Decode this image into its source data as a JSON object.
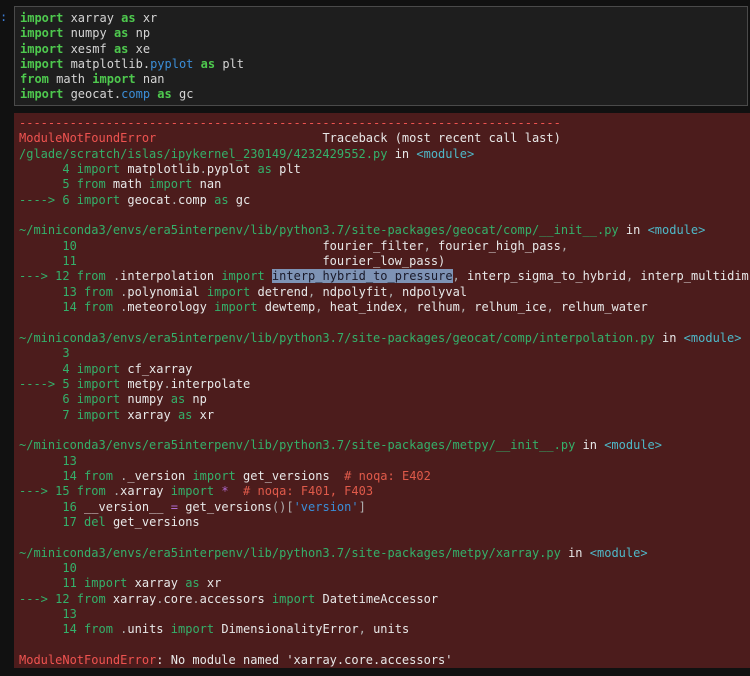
{
  "prompt": ":",
  "input_code": [
    [
      [
        "kw",
        "import"
      ],
      [
        "plain",
        " xarray "
      ],
      [
        "kw",
        "as"
      ],
      [
        "plain",
        " xr"
      ]
    ],
    [
      [
        "kw",
        "import"
      ],
      [
        "plain",
        " numpy "
      ],
      [
        "kw",
        "as"
      ],
      [
        "plain",
        " np"
      ]
    ],
    [
      [
        "kw",
        "import"
      ],
      [
        "plain",
        " xesmf "
      ],
      [
        "kw",
        "as"
      ],
      [
        "plain",
        " xe"
      ]
    ],
    [
      [
        "kw",
        "import"
      ],
      [
        "plain",
        " matplotlib."
      ],
      [
        "attr",
        "pyplot"
      ],
      [
        "plain",
        " "
      ],
      [
        "kw",
        "as"
      ],
      [
        "plain",
        " plt"
      ]
    ],
    [
      [
        "kw",
        "from"
      ],
      [
        "plain",
        " math "
      ],
      [
        "kw",
        "import"
      ],
      [
        "plain",
        " nan"
      ]
    ],
    [
      [
        "kw",
        "import"
      ],
      [
        "plain",
        " geocat."
      ],
      [
        "attr",
        "comp"
      ],
      [
        "plain",
        " "
      ],
      [
        "kw",
        "as"
      ],
      [
        "plain",
        " gc"
      ]
    ]
  ],
  "traceback": [
    [
      [
        "red",
        "---------------------------------------------------------------------------"
      ]
    ],
    [
      [
        "red",
        "ModuleNotFoundError"
      ],
      [
        "wt",
        "                       Traceback (most recent call last)"
      ]
    ],
    [
      [
        "grn",
        "/glade/scratch/islas/ipykernel_230149/4232429552.py"
      ],
      [
        "wt",
        " in "
      ],
      [
        "cyan",
        "<module>"
      ]
    ],
    [
      [
        "lno",
        "      4 "
      ],
      [
        "okw",
        "import"
      ],
      [
        "wt",
        " matplotlib"
      ],
      [
        "punct",
        "."
      ],
      [
        "wt",
        "pyplot "
      ],
      [
        "okw",
        "as"
      ],
      [
        "wt",
        " plt"
      ]
    ],
    [
      [
        "lno",
        "      5 "
      ],
      [
        "okw",
        "from"
      ],
      [
        "wt",
        " math "
      ],
      [
        "okw",
        "import"
      ],
      [
        "wt",
        " nan"
      ]
    ],
    [
      [
        "arrow",
        "----> 6 "
      ],
      [
        "okw",
        "import"
      ],
      [
        "wt",
        " geocat"
      ],
      [
        "punct",
        "."
      ],
      [
        "wt",
        "comp "
      ],
      [
        "okw",
        "as"
      ],
      [
        "wt",
        " gc"
      ]
    ],
    [
      [
        "wt",
        " "
      ]
    ],
    [
      [
        "grn",
        "~/miniconda3/envs/era5interpenv/lib/python3.7/site-packages/geocat/comp/__init__.py"
      ],
      [
        "wt",
        " in "
      ],
      [
        "cyan",
        "<module>"
      ]
    ],
    [
      [
        "lno",
        "      10 "
      ],
      [
        "wt",
        "                                 fourier_filter"
      ],
      [
        "punct",
        ","
      ],
      [
        "wt",
        " fourier_high_pass"
      ],
      [
        "punct",
        ","
      ]
    ],
    [
      [
        "lno",
        "      11 "
      ],
      [
        "wt",
        "                                 fourier_low_pass)"
      ]
    ],
    [
      [
        "arrow",
        "---> 12 "
      ],
      [
        "okw",
        "from"
      ],
      [
        "wt",
        " "
      ],
      [
        "punct",
        "."
      ],
      [
        "wt",
        "interpolation "
      ],
      [
        "okw",
        "import"
      ],
      [
        "wt",
        " "
      ],
      [
        "hl",
        "interp_hybrid_to_pressure"
      ],
      [
        "punct",
        ","
      ],
      [
        "wt",
        " interp_sigma_to_hybrid"
      ],
      [
        "punct",
        ","
      ],
      [
        "wt",
        " interp_multidim"
      ]
    ],
    [
      [
        "lno",
        "      13 "
      ],
      [
        "okw",
        "from"
      ],
      [
        "wt",
        " "
      ],
      [
        "punct",
        "."
      ],
      [
        "wt",
        "polynomial "
      ],
      [
        "okw",
        "import"
      ],
      [
        "wt",
        " detrend"
      ],
      [
        "punct",
        ","
      ],
      [
        "wt",
        " ndpolyfit"
      ],
      [
        "punct",
        ","
      ],
      [
        "wt",
        " ndpolyval"
      ]
    ],
    [
      [
        "lno",
        "      14 "
      ],
      [
        "okw",
        "from"
      ],
      [
        "wt",
        " "
      ],
      [
        "punct",
        "."
      ],
      [
        "wt",
        "meteorology "
      ],
      [
        "okw",
        "import"
      ],
      [
        "wt",
        " dewtemp"
      ],
      [
        "punct",
        ","
      ],
      [
        "wt",
        " heat_index"
      ],
      [
        "punct",
        ","
      ],
      [
        "wt",
        " relhum"
      ],
      [
        "punct",
        ","
      ],
      [
        "wt",
        " relhum_ice"
      ],
      [
        "punct",
        ","
      ],
      [
        "wt",
        " relhum_water"
      ]
    ],
    [
      [
        "wt",
        " "
      ]
    ],
    [
      [
        "grn",
        "~/miniconda3/envs/era5interpenv/lib/python3.7/site-packages/geocat/comp/interpolation.py"
      ],
      [
        "wt",
        " in "
      ],
      [
        "cyan",
        "<module>"
      ]
    ],
    [
      [
        "lno",
        "      3 "
      ]
    ],
    [
      [
        "lno",
        "      4 "
      ],
      [
        "okw",
        "import"
      ],
      [
        "wt",
        " cf_xarray"
      ]
    ],
    [
      [
        "arrow",
        "----> 5 "
      ],
      [
        "okw",
        "import"
      ],
      [
        "wt",
        " metpy"
      ],
      [
        "punct",
        "."
      ],
      [
        "wt",
        "interpolate"
      ]
    ],
    [
      [
        "lno",
        "      6 "
      ],
      [
        "okw",
        "import"
      ],
      [
        "wt",
        " numpy "
      ],
      [
        "okw",
        "as"
      ],
      [
        "wt",
        " np"
      ]
    ],
    [
      [
        "lno",
        "      7 "
      ],
      [
        "okw",
        "import"
      ],
      [
        "wt",
        " xarray "
      ],
      [
        "okw",
        "as"
      ],
      [
        "wt",
        " xr"
      ]
    ],
    [
      [
        "wt",
        " "
      ]
    ],
    [
      [
        "grn",
        "~/miniconda3/envs/era5interpenv/lib/python3.7/site-packages/metpy/__init__.py"
      ],
      [
        "wt",
        " in "
      ],
      [
        "cyan",
        "<module>"
      ]
    ],
    [
      [
        "lno",
        "      13 "
      ]
    ],
    [
      [
        "lno",
        "      14 "
      ],
      [
        "okw",
        "from"
      ],
      [
        "wt",
        " "
      ],
      [
        "punct",
        "."
      ],
      [
        "wt",
        "_version "
      ],
      [
        "okw",
        "import"
      ],
      [
        "wt",
        " get_versions  "
      ],
      [
        "comment",
        "# noqa: E402"
      ]
    ],
    [
      [
        "arrow",
        "---> 15 "
      ],
      [
        "okw",
        "from"
      ],
      [
        "wt",
        " "
      ],
      [
        "punct",
        "."
      ],
      [
        "wt",
        "xarray "
      ],
      [
        "okw",
        "import"
      ],
      [
        "wt",
        " "
      ],
      [
        "op",
        "*"
      ],
      [
        "wt",
        "  "
      ],
      [
        "comment",
        "# noqa: F401, F403"
      ]
    ],
    [
      [
        "lno",
        "      16 "
      ],
      [
        "wt",
        "__version__ "
      ],
      [
        "op",
        "="
      ],
      [
        "wt",
        " get_versions"
      ],
      [
        "punct",
        "()"
      ],
      [
        "punct",
        "["
      ],
      [
        "str",
        "'version'"
      ],
      [
        "punct",
        "]"
      ]
    ],
    [
      [
        "lno",
        "      17 "
      ],
      [
        "okw",
        "del"
      ],
      [
        "wt",
        " get_versions"
      ]
    ],
    [
      [
        "wt",
        " "
      ]
    ],
    [
      [
        "grn",
        "~/miniconda3/envs/era5interpenv/lib/python3.7/site-packages/metpy/xarray.py"
      ],
      [
        "wt",
        " in "
      ],
      [
        "cyan",
        "<module>"
      ]
    ],
    [
      [
        "lno",
        "      10 "
      ]
    ],
    [
      [
        "lno",
        "      11 "
      ],
      [
        "okw",
        "import"
      ],
      [
        "wt",
        " xarray "
      ],
      [
        "okw",
        "as"
      ],
      [
        "wt",
        " xr"
      ]
    ],
    [
      [
        "arrow",
        "---> 12 "
      ],
      [
        "okw",
        "from"
      ],
      [
        "wt",
        " xarray"
      ],
      [
        "punct",
        "."
      ],
      [
        "wt",
        "core"
      ],
      [
        "punct",
        "."
      ],
      [
        "wt",
        "accessors "
      ],
      [
        "okw",
        "import"
      ],
      [
        "wt",
        " DatetimeAccessor"
      ]
    ],
    [
      [
        "lno",
        "      13 "
      ]
    ],
    [
      [
        "lno",
        "      14 "
      ],
      [
        "okw",
        "from"
      ],
      [
        "wt",
        " "
      ],
      [
        "punct",
        "."
      ],
      [
        "wt",
        "units "
      ],
      [
        "okw",
        "import"
      ],
      [
        "wt",
        " DimensionalityError"
      ],
      [
        "punct",
        ","
      ],
      [
        "wt",
        " units"
      ]
    ],
    [
      [
        "wt",
        " "
      ]
    ],
    [
      [
        "red",
        "ModuleNotFoundError"
      ],
      [
        "wt",
        ": No module named 'xarray.core.accessors'"
      ]
    ]
  ]
}
